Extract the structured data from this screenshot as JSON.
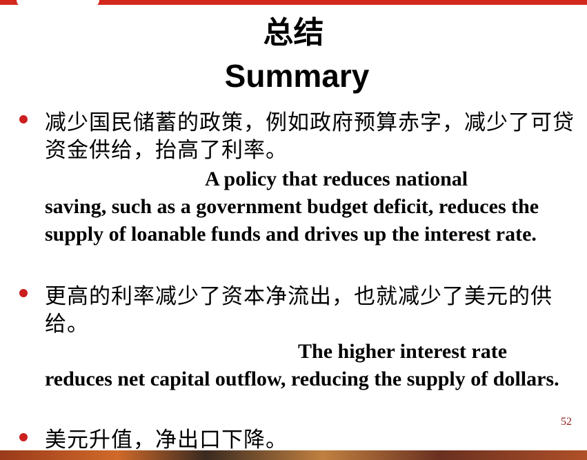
{
  "title_cn": "总结",
  "title_en": "Summary",
  "bullets": [
    {
      "cn": "减少国民储蓄的政策，例如政府预算赤字，减少了可贷资金供给，抬高了利率。",
      "en_first": "A policy that reduces national",
      "en_rest": "saving, such as a government budget deficit, reduces the supply of loanable funds and drives up the interest rate."
    },
    {
      "cn": "更高的利率减少了资本净流出，也就减少了美元的供给。",
      "en_first": "The higher interest rate",
      "en_rest": "reduces net capital outflow, reducing the supply of dollars."
    },
    {
      "cn": "美元升值，净出口下降。"
    }
  ],
  "page_number": "52",
  "colors": {
    "accent_red": "#d2281e",
    "bullet_red": "#cc1f1f",
    "page_number": "#8b1a1a"
  }
}
